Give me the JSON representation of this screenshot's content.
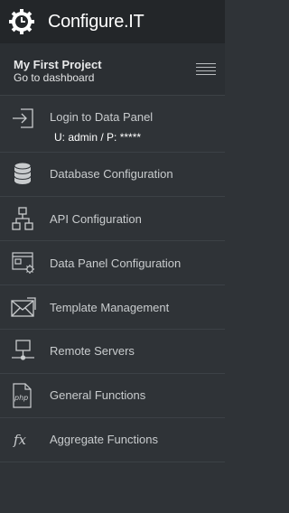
{
  "header": {
    "brand": "Configure.IT",
    "logo_icon": "gear-clock-logo"
  },
  "project": {
    "name": "My First Project",
    "link": "Go to dashboard",
    "menu_icon": "hamburger-icon"
  },
  "menu": [
    {
      "label": "Login to Data Panel",
      "detail": "U: admin / P: *****",
      "icon": "login-icon"
    },
    {
      "label": "Database Configuration",
      "icon": "database-icon"
    },
    {
      "label": "API Configuration",
      "icon": "sitemap-icon"
    },
    {
      "label": "Data Panel Configuration",
      "icon": "window-gear-icon"
    },
    {
      "label": "Template Management",
      "icon": "envelope-icon"
    },
    {
      "label": "Remote Servers",
      "icon": "monitor-icon"
    },
    {
      "label": "General Functions",
      "icon": "php-file-icon"
    },
    {
      "label": "Aggregate Functions",
      "icon": "fx-icon"
    }
  ],
  "colors": {
    "sidebar_bg": "#2f3337",
    "header_bg": "#232629",
    "divider": "#3c4146",
    "text": "#c9ccce"
  }
}
